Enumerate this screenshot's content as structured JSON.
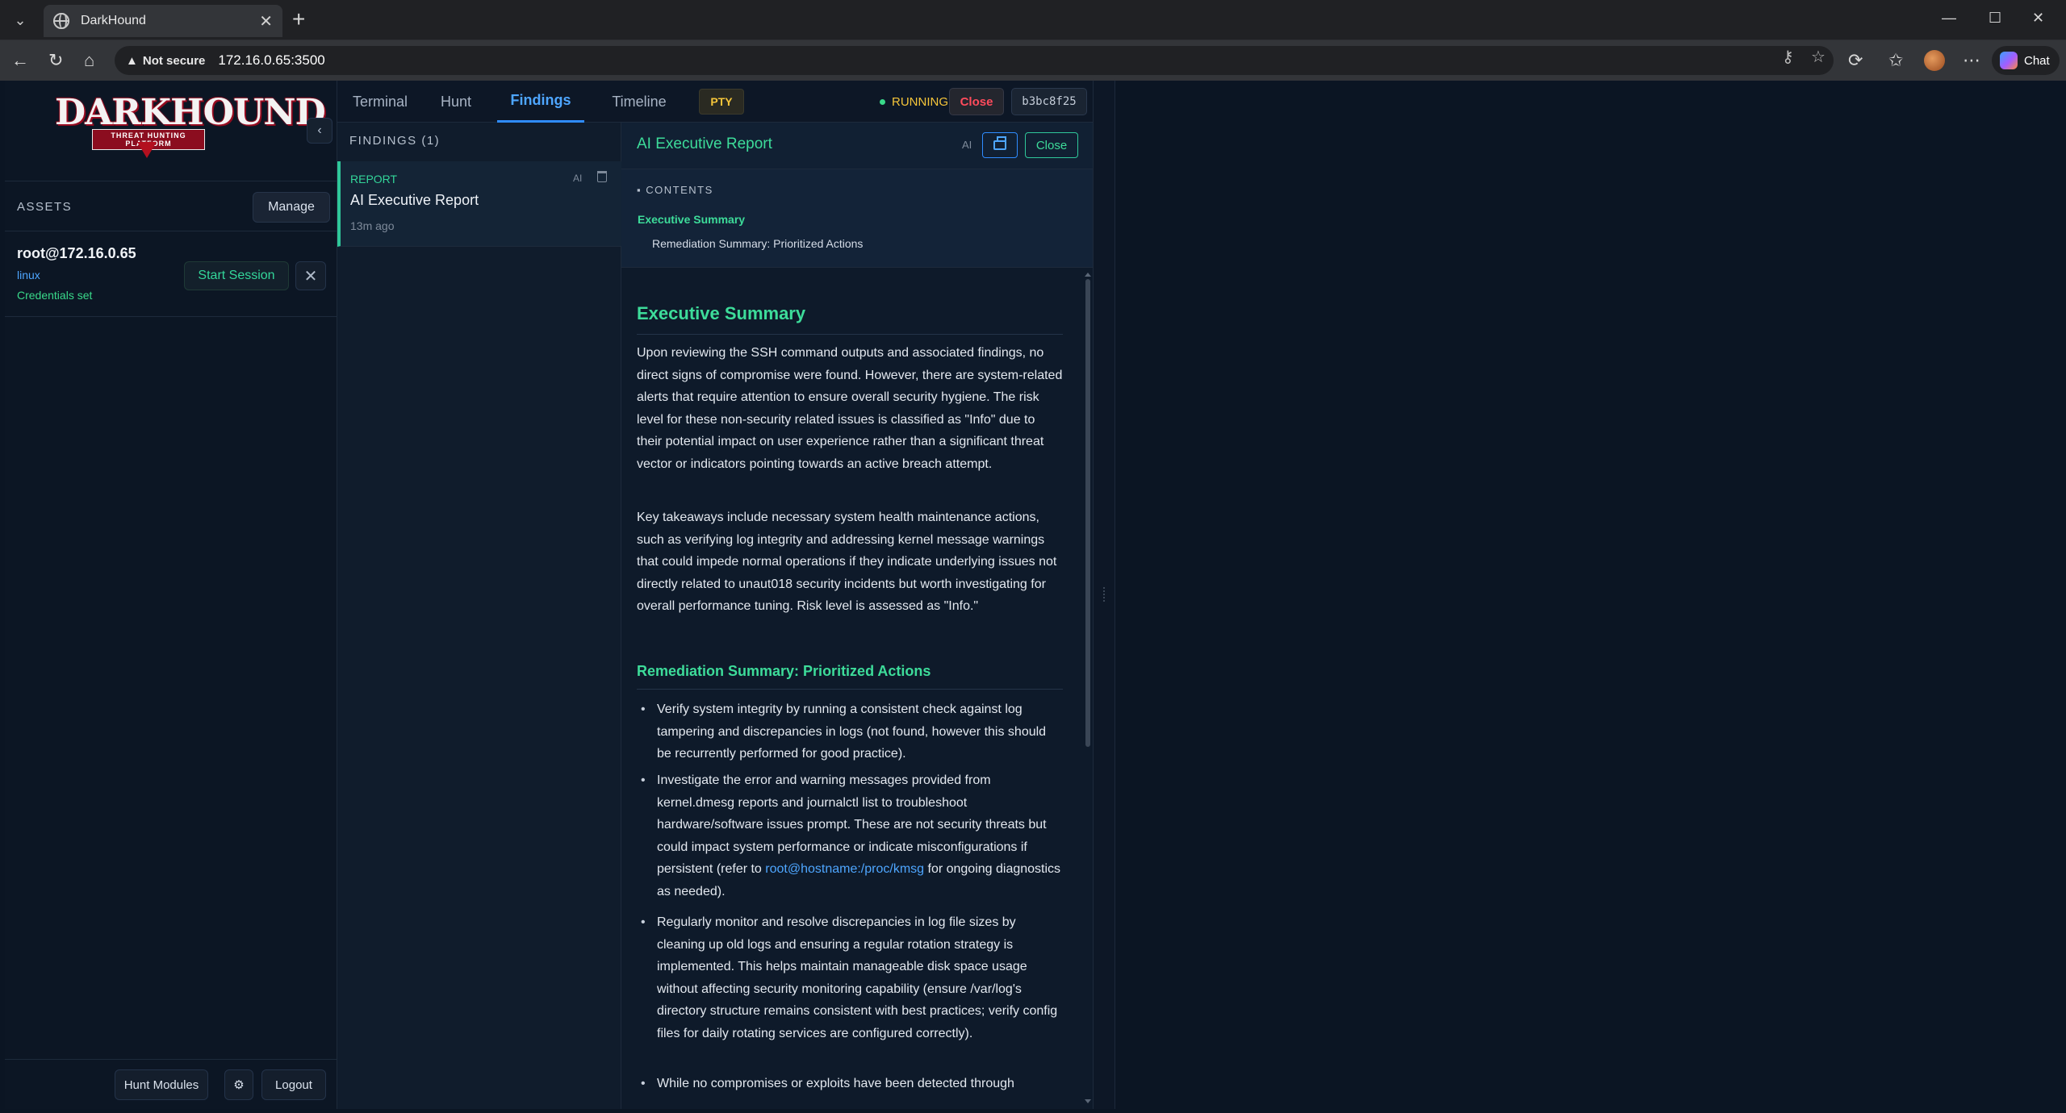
{
  "browser": {
    "tab_title": "DarkHound",
    "security_label": "Not secure",
    "url": "172.16.0.65:3500",
    "chat_label": "Chat"
  },
  "sidebar": {
    "logo_text": "DARKHOUND",
    "logo_tagline": "THREAT HUNTING PLATFORM",
    "assets_heading": "ASSETS",
    "manage_label": "Manage",
    "asset": {
      "host": "root@172.16.0.65",
      "os": "linux",
      "credentials": "Credentials set",
      "start_label": "Start Session"
    },
    "footer": {
      "hunt_modules_label": "Hunt Modules",
      "logout_label": "Logout"
    }
  },
  "topnav": {
    "tabs": [
      {
        "label": "Terminal"
      },
      {
        "label": "Hunt"
      },
      {
        "label": "Findings"
      },
      {
        "label": "Timeline"
      }
    ],
    "mode_badge": "PTY",
    "status": "RUNNING",
    "close_label": "Close",
    "session_id": "b3bc8f25"
  },
  "findings": {
    "heading": "FINDINGS (1)",
    "items": [
      {
        "type": "REPORT",
        "ai": "AI",
        "title": "AI Executive Report",
        "age": "13m ago"
      }
    ]
  },
  "report": {
    "title": "AI Executive Report",
    "ai_badge": "AI",
    "close_label": "Close",
    "toc": {
      "heading": "CONTENTS",
      "items": [
        "Executive Summary",
        "Remediation Summary: Prioritized Actions"
      ]
    },
    "summary_heading": "Executive Summary",
    "para1": "Upon reviewing the SSH command outputs and associated findings, no direct signs of compromise were found. However, there are system-related alerts that require attention to ensure overall security hygiene. The risk level for these non-security related issues is classified as \"Info\" due to their potential impact on user experience rather than a significant threat vector or indicators pointing towards an active breach attempt.",
    "para2": "Key takeaways include necessary system health maintenance actions, such as verifying log integrity and addressing kernel message warnings that could impede normal operations if they indicate underlying issues not directly related to unaut018 security incidents but worth investigating for overall performance tuning. Risk level is assessed as \"Info.\"",
    "remediation_heading": "Remediation Summary: Prioritized Actions",
    "bullet1": "Verify system integrity by running a consistent check against log tampering and discrepancies in logs (not found, however this should be recurrently performed for good practice).",
    "bullet2_pre": "Investigate the error and warning messages provided from kernel.dmesg reports and journalctl list to troubleshoot hardware/software issues prompt. These are not security threats but could impact system performance or indicate misconfigurations if persistent (refer to ",
    "bullet2_link": "root@hostname:/proc/kmsg",
    "bullet2_post": " for ongoing diagnostics as needed).",
    "bullet3": "Regularly monitor and resolve discrepancies in log file sizes by cleaning up old logs and ensuring a regular rotation strategy is implemented. This helps maintain manageable disk space usage without affecting security monitoring capability (ensure /var/log's directory structure remains consistent with best practices; verify config files for daily rotating services are configured correctly).",
    "bullet4": "While no compromises or exploits have been detected through"
  }
}
